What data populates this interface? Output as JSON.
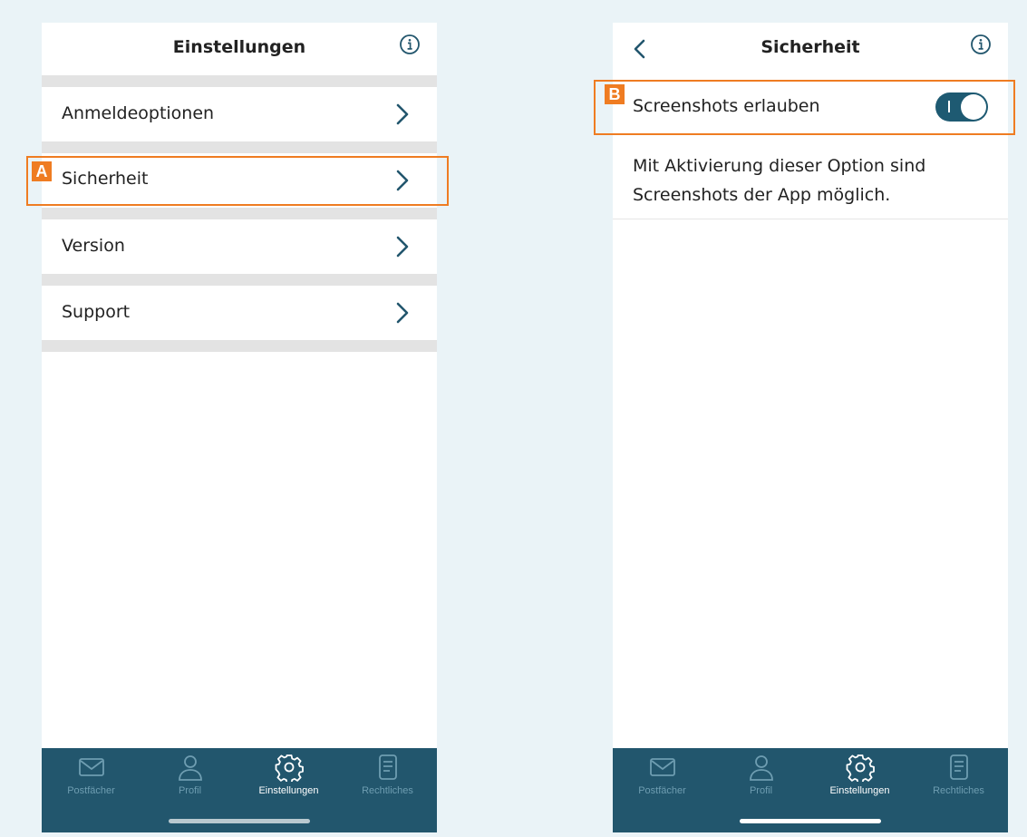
{
  "left_screen": {
    "title": "Einstellungen",
    "rows": [
      {
        "label": "Anmeldeoptionen"
      },
      {
        "label": "Sicherheit"
      },
      {
        "label": "Version"
      },
      {
        "label": "Support"
      }
    ],
    "callout_tag": "A"
  },
  "right_screen": {
    "title": "Sicherheit",
    "setting_label": "Screenshots erlauben",
    "toggle_state": "on",
    "description": "Mit Aktivierung dieser Option sind Screenshots der App möglich.",
    "callout_tag": "B"
  },
  "tabbar": {
    "items": [
      {
        "label": "Postfächer",
        "icon": "mail-icon"
      },
      {
        "label": "Profil",
        "icon": "person-icon"
      },
      {
        "label": "Einstellungen",
        "icon": "gear-icon"
      },
      {
        "label": "Rechtliches",
        "icon": "document-icon"
      }
    ],
    "active": "Einstellungen"
  },
  "colors": {
    "accent": "#22566d",
    "callout": "#ef7c22",
    "toggle_on": "#1e5a72"
  }
}
